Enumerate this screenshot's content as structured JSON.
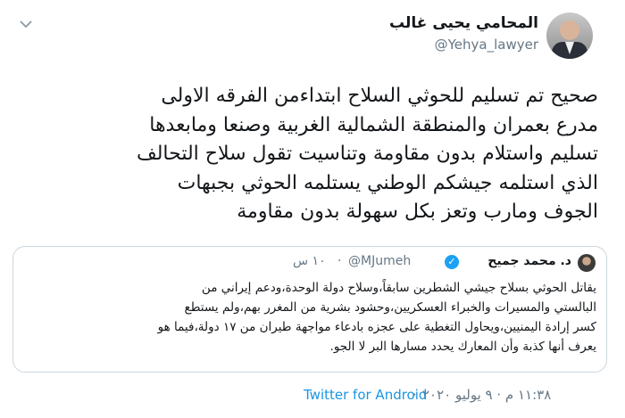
{
  "author": {
    "name": "المحامي يحيى غالب",
    "handle": "@Yehya_lawyer"
  },
  "tweet": {
    "lines": [
      "صحيح تم تسليم للحوثي السلاح ابتداءمن الفرقه الاولى",
      "مدرع بعمران والمنطقة الشمالية الغربية وصنعا ومابعدها",
      "تسليم واستلام بدون مقاومة وتناسيت تقول سلاح التحالف",
      "الذي استلمه جيشكم الوطني يستلمه الحوثي بجبهات",
      "الجوف ومارب وتعز بكل سهولة بدون مقاومة"
    ]
  },
  "quote": {
    "name": "د. محمد جميح",
    "handle": "@MJumeh",
    "separator": "·",
    "time": "١٠ س",
    "lines": [
      "يقاتل الحوثي بسلاح جيشي الشطرين سابقاً،وسلاح دولة الوحدة،ودعم إيراني من",
      "البالستي والمسيرات والخبراء العسكريين،وحشود بشرية من المغرر بهم،ولم يستطع",
      "كسر إرادة اليمنيين،ويحاول التغطية على عجزه بادعاء مواجهة طيران من ١٧ دولة،فيما هو",
      "يعرف أنها كذبة وأن المعارك يحدد مسارها البر لا الجو."
    ]
  },
  "footer": {
    "time": "١١:٣٨ م · ٩ يوليو ٢٠٢٠",
    "separator": "·",
    "source": "Twitter for Android"
  },
  "icons": {
    "more": "chevron-down-icon",
    "verified": "verified-badge-icon"
  },
  "colors": {
    "link": "#1b95e0",
    "muted": "#657786",
    "verified": "#1da1f2"
  }
}
